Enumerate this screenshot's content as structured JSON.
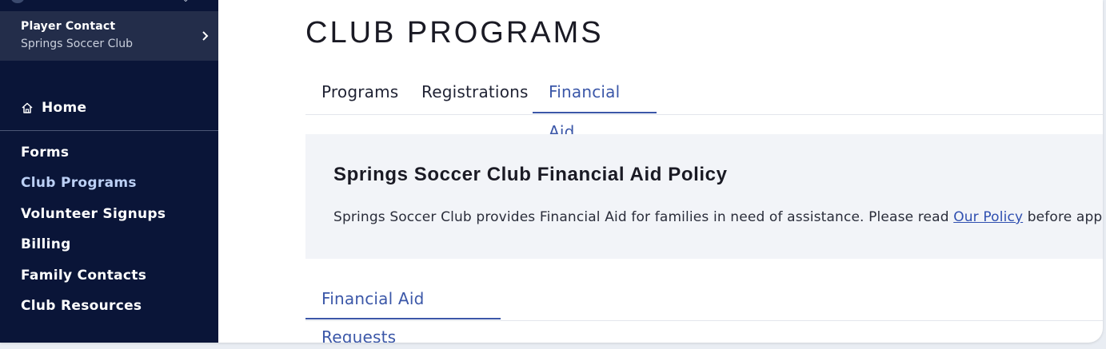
{
  "sidebar": {
    "contact": {
      "role": "Player Contact",
      "club": "Springs Soccer Club"
    },
    "home_label": "Home",
    "items": [
      {
        "label": "Forms"
      },
      {
        "label": "Club Programs",
        "active": true
      },
      {
        "label": "Volunteer Signups"
      },
      {
        "label": "Billing"
      },
      {
        "label": "Family Contacts"
      },
      {
        "label": "Club Resources"
      }
    ]
  },
  "main": {
    "title": "CLUB PROGRAMS",
    "tabs": [
      {
        "label": "Programs"
      },
      {
        "label": "Registrations"
      },
      {
        "label": "Financial Aid",
        "active": true
      }
    ],
    "policy": {
      "heading": "Springs Soccer Club Financial Aid Policy",
      "text_before": "Springs Soccer Club provides Financial Aid for families in need of assistance. Please read ",
      "link_text": "Our Policy",
      "text_after": " before applying."
    },
    "subtabs": [
      {
        "label": "Financial Aid Requests",
        "active": true
      }
    ]
  },
  "colors": {
    "sidebar_bg": "#0a1538",
    "accent": "#3b57a8",
    "link": "#2f4fb0",
    "panel_bg": "#f2f4f8"
  },
  "icons": {
    "home": "home-icon",
    "contact_chevron": "chevron-right-icon"
  }
}
